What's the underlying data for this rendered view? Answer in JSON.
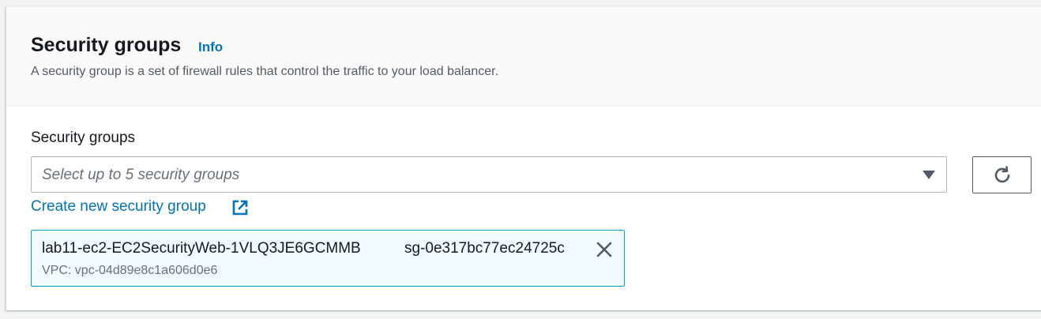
{
  "header": {
    "title": "Security groups",
    "info_label": "Info",
    "description": "A security group is a set of firewall rules that control the traffic to your load balancer."
  },
  "field": {
    "label": "Security groups",
    "placeholder": "Select up to 5 security groups",
    "create_link": "Create new security group"
  },
  "selected": [
    {
      "name": "lab11-ec2-EC2SecurityWeb-1VLQ3JE6GCMMB",
      "id": "sg-0e317bc77ec24725c",
      "vpc": "VPC: vpc-04d89e8c1a606d0e6"
    }
  ],
  "icons": {
    "refresh": "refresh-icon",
    "external": "external-link-icon",
    "close": "close-icon",
    "caret": "caret-down-icon"
  },
  "colors": {
    "link": "#0073bb",
    "token_border": "#00a1c9",
    "token_bg": "#f1faff",
    "text": "#16191f"
  }
}
